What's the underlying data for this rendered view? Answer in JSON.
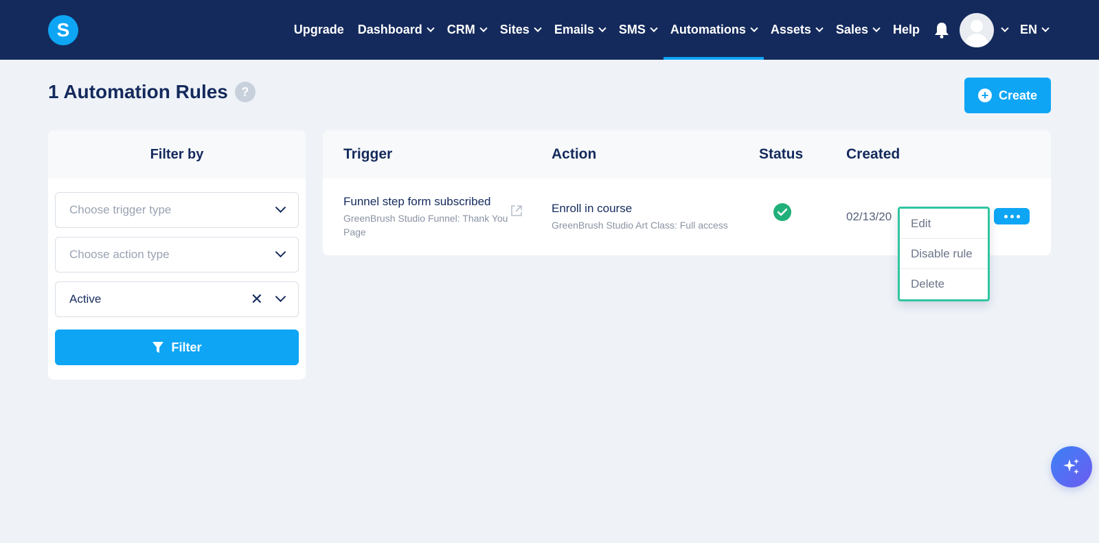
{
  "nav": {
    "logo_letter": "S",
    "items": [
      {
        "label": "Upgrade",
        "dropdown": false,
        "active": false
      },
      {
        "label": "Dashboard",
        "dropdown": true,
        "active": false
      },
      {
        "label": "CRM",
        "dropdown": true,
        "active": false
      },
      {
        "label": "Sites",
        "dropdown": true,
        "active": false
      },
      {
        "label": "Emails",
        "dropdown": true,
        "active": false
      },
      {
        "label": "SMS",
        "dropdown": true,
        "active": false
      },
      {
        "label": "Automations",
        "dropdown": true,
        "active": true
      },
      {
        "label": "Assets",
        "dropdown": true,
        "active": false
      },
      {
        "label": "Sales",
        "dropdown": true,
        "active": false
      },
      {
        "label": "Help",
        "dropdown": false,
        "active": false
      }
    ],
    "language": "EN",
    "icons": {
      "notifications": "bell-icon",
      "avatar": "user-avatar"
    }
  },
  "page": {
    "title": "1 Automation Rules",
    "help_icon": "?",
    "create_label": "Create"
  },
  "filter": {
    "heading": "Filter by",
    "trigger_placeholder": "Choose trigger type",
    "action_placeholder": "Choose action type",
    "status_value": "Active",
    "filter_label": "Filter"
  },
  "table": {
    "headers": {
      "trigger": "Trigger",
      "action": "Action",
      "status": "Status",
      "created": "Created"
    },
    "rows": [
      {
        "trigger": "Funnel step form subscribed",
        "trigger_detail": "GreenBrush Studio Funnel: Thank You Page",
        "action": "Enroll in course",
        "action_detail": "GreenBrush Studio Art Class: Full access",
        "status": "active",
        "created": "02/13/20"
      }
    ]
  },
  "row_menu": {
    "items": [
      "Edit",
      "Disable rule",
      "Delete"
    ]
  },
  "colors": {
    "nav_bg": "#142a5c",
    "accent": "#0ea5f5",
    "success": "#20b07a",
    "menu_highlight": "#2fc5a0",
    "page_bg": "#eff3f8"
  }
}
